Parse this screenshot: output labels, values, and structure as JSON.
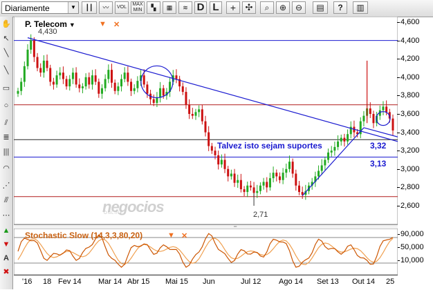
{
  "toolbar": {
    "period": "Diariamente",
    "vol_label": "VOL",
    "maxmin_line1": "MAX",
    "maxmin_line2": "MIN",
    "d_label": "D",
    "l_label": "L"
  },
  "chart": {
    "title": "P. Telecom",
    "annotation_high": "4,430",
    "annotation_low": "2,71",
    "level_332": "3,32",
    "level_313": "3,13",
    "middle_text": "Talvez isto sejam  suportes",
    "watermark": "negocios",
    "watermark_sub": "ONLINE",
    "y_labels": [
      "4,600",
      "4,400",
      "4,200",
      "4,000",
      "3,800",
      "3,600",
      "3,400",
      "3,200",
      "3,000",
      "2,800",
      "2,600"
    ],
    "x_labels": [
      "'16",
      "18",
      "Fev 14",
      "Mar 14",
      "Abr 15",
      "Mai 15",
      "Jun",
      "Jul 12",
      "Ago 14",
      "Set 13",
      "Out 14",
      "25"
    ],
    "colors": {
      "up": "#22aa22",
      "down": "#cc1111",
      "trend": "#1a1ad0",
      "stoch_k": "#cc5500",
      "stoch_d": "#f0a050"
    }
  },
  "stochastic": {
    "title": "Stochastic Slow (14,3,3,80,20)",
    "y_labels": [
      "90,000",
      "50,000",
      "10,000"
    ]
  },
  "chart_data": {
    "type": "candlestick",
    "title": "P. Telecom",
    "ylim": [
      2.55,
      4.65
    ],
    "x": [
      "'16",
      "18",
      "Fev 14",
      "Mar 14",
      "Abr 15",
      "Mai 15",
      "Jun",
      "Jul 12",
      "Ago 14",
      "Set 13",
      "Out 14",
      "25"
    ],
    "close": [
      3.85,
      3.95,
      4.12,
      4.3,
      4.4,
      4.22,
      4.1,
      4.05,
      4.18,
      4.1,
      3.95,
      3.92,
      4.02,
      4.05,
      3.98,
      3.9,
      3.98,
      4.05,
      3.92,
      3.88,
      3.9,
      4.0,
      3.92,
      4.02,
      3.95,
      3.82,
      3.88,
      3.98,
      4.08,
      3.94,
      3.85,
      3.9,
      3.98,
      4.05,
      3.95,
      3.85,
      3.88,
      3.96,
      4.02,
      3.92,
      3.82,
      3.76,
      3.72,
      3.78,
      3.88,
      3.8,
      3.84,
      3.95,
      4.02,
      3.98,
      3.9,
      3.84,
      3.7,
      3.6,
      3.58,
      3.62,
      3.65,
      3.52,
      3.4,
      3.25,
      3.2,
      3.15,
      3.05,
      3.1,
      3.0,
      2.92,
      2.95,
      2.85,
      2.88,
      2.78,
      2.75,
      2.82,
      2.8,
      2.74,
      2.76,
      2.82,
      2.86,
      2.8,
      2.9,
      2.96,
      2.92,
      2.88,
      2.96,
      3.0,
      3.08,
      2.95,
      2.82,
      2.75,
      2.72,
      2.76,
      2.82,
      2.86,
      2.92,
      2.98,
      3.04,
      3.1,
      3.18,
      3.2,
      3.24,
      3.3,
      3.34,
      3.3,
      3.38,
      3.46,
      3.4,
      3.38,
      3.52,
      3.58,
      3.66,
      3.6,
      3.5,
      3.58,
      3.64,
      3.68,
      3.62,
      3.55,
      3.42
    ],
    "annotations": {
      "high": 4.43,
      "low": 2.71
    },
    "horizontal_levels": [
      4.4,
      3.7,
      3.32,
      3.13,
      2.7
    ],
    "trendline_down": {
      "from": 4.43,
      "to": 3.3
    },
    "trendline_up": {
      "from": 2.71,
      "to": 3.45
    }
  }
}
